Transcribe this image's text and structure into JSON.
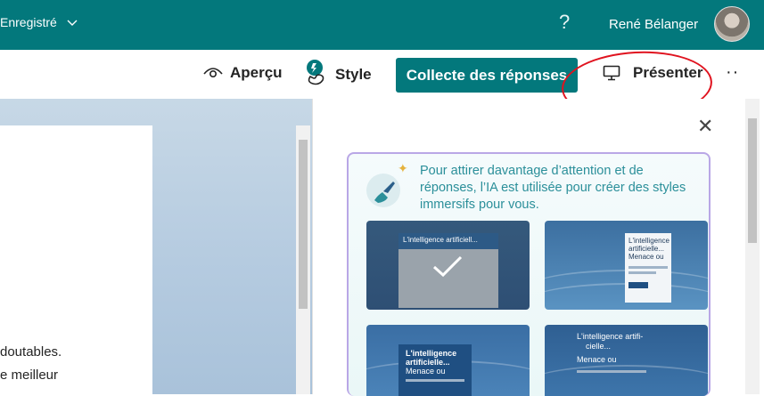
{
  "topbar": {
    "saved_label": "Enregistré",
    "help_glyph": "?",
    "user_name": "René Bélanger"
  },
  "toolbar": {
    "preview_label": "Aperçu",
    "style_label": "Style",
    "collect_label": "Collecte des réponses",
    "present_label": "Présenter",
    "more_glyph": "··"
  },
  "document": {
    "line1": "doutables.",
    "line2": "e meilleur"
  },
  "style_panel": {
    "close_glyph": "✕",
    "ai_message": "Pour attirer davantage d’attention et de réponses, l’IA est utilisée pour créer des styles immersifs pour vous.",
    "tiles": [
      {
        "title": "L'intelligence artificiell..."
      },
      {
        "title_line1": "L'intelligence",
        "title_line2": "artificielle...",
        "title_line3": "Menace ou"
      },
      {
        "title_line1": "L'intelligence",
        "title_line2": "artificielle...",
        "title_line3": "Menace ou"
      },
      {
        "title_line1": "L'intelligence artifi-",
        "title_line2": "cielle...",
        "title_line3": "Menace ou"
      }
    ]
  },
  "colors": {
    "brand": "#03787c",
    "annotation": "#e0131f",
    "ai_text": "#2b8f9a"
  }
}
